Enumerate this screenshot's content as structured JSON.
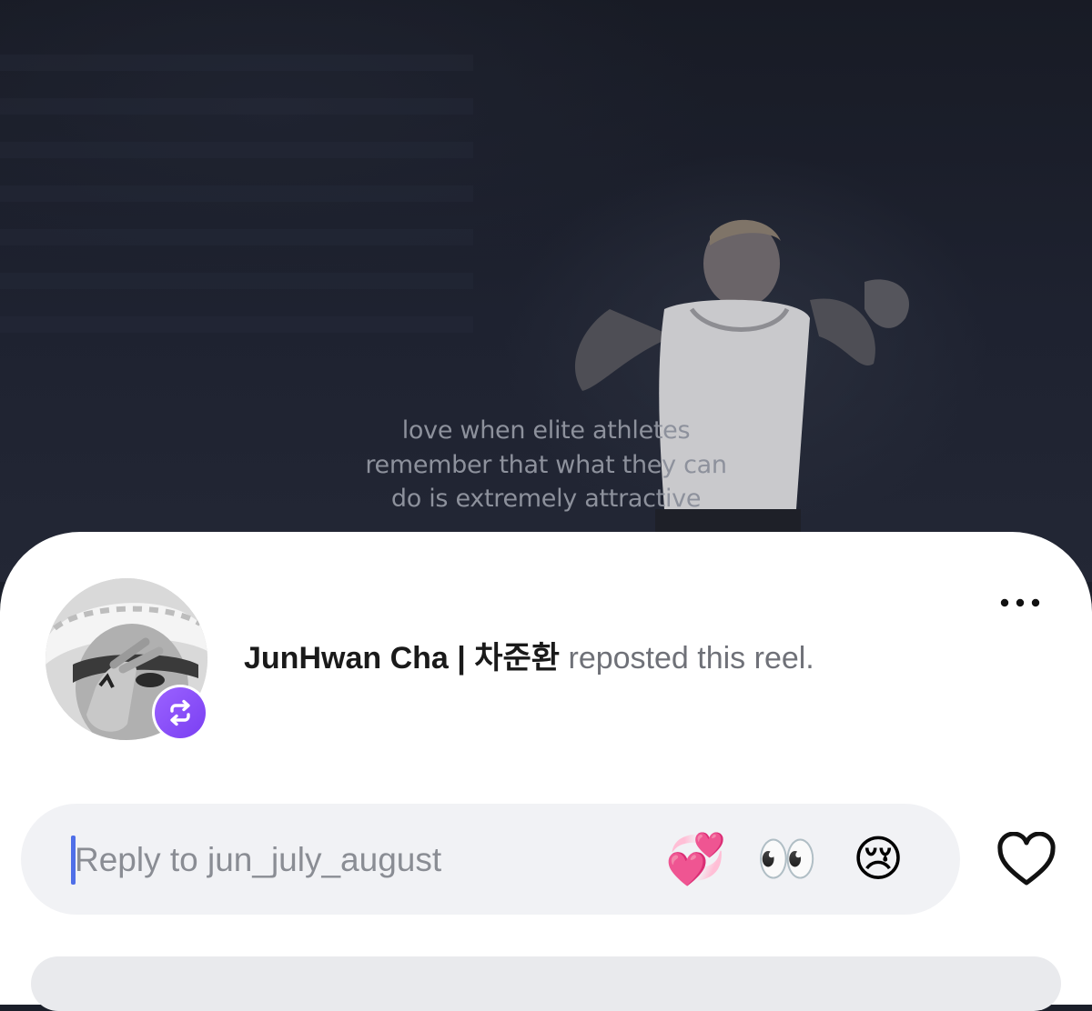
{
  "reel": {
    "caption_lines": [
      "love when elite athletes",
      "remember that what they can",
      "do is extremely attractive"
    ]
  },
  "repost": {
    "username": "JunHwan Cha | 차준환",
    "action_text": "reposted this reel."
  },
  "reply": {
    "placeholder": "Reply to jun_july_august",
    "value": ""
  },
  "quick_reactions": [
    "💞",
    "👀",
    "😢"
  ],
  "icons": {
    "more": "more-dots-icon",
    "repost": "repost-icon",
    "like": "heart-outline-icon"
  },
  "colors": {
    "repost_badge": "#8b4ff8",
    "cursor": "#4f6fe8",
    "reply_bar": "#f1f2f5"
  }
}
